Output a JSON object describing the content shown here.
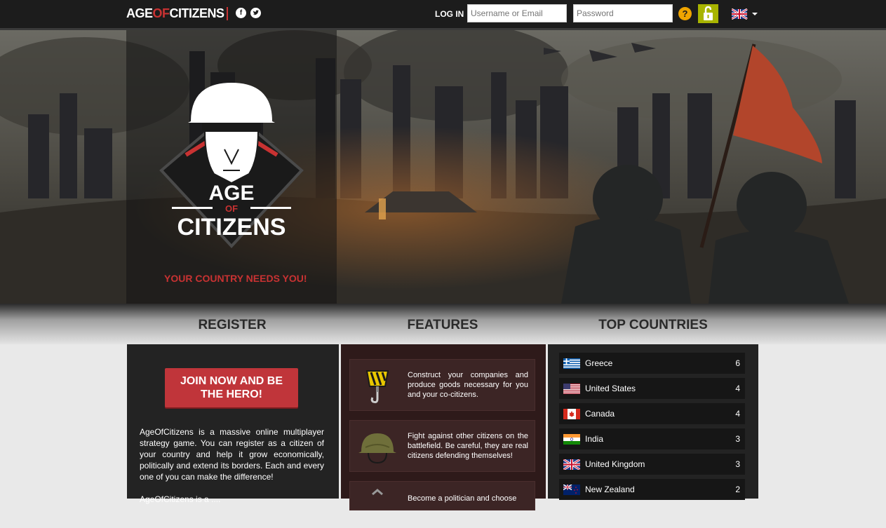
{
  "header": {
    "logo_age": "AGE",
    "logo_of": "OF",
    "logo_citizens": "CITIZENS",
    "login_label": "LOG IN",
    "username_placeholder": "Username or Email",
    "password_placeholder": "Password",
    "help_symbol": "?",
    "social": [
      "facebook-icon",
      "twitter-icon"
    ],
    "language": "uk-flag-icon"
  },
  "hero": {
    "emblem_line1": "AGE",
    "emblem_line2": "OF",
    "emblem_line3": "CITIZENS",
    "tagline": "YOUR COUNTRY NEEDS YOU!"
  },
  "sections": {
    "register": "REGISTER",
    "features": "FEATURES",
    "top_countries": "TOP COUNTRIES"
  },
  "register": {
    "join_button": "JOIN NOW AND BE THE HERO!",
    "description": "AgeOfCitizens is a massive online multiplayer strategy game. You can register as a citizen of your country and help it grow economically, politically and extend its borders. Each and every one of you can make the difference!",
    "description2": "AgeOfCitizens is a ...."
  },
  "features": [
    {
      "icon": "crane-hook-icon",
      "text": "Construct your companies and produce goods necessary for you and your co-citizens."
    },
    {
      "icon": "helmet-icon",
      "text": "Fight against other citizens on the battlefield. Be careful, they are real citizens defending themselves!"
    },
    {
      "icon": "politics-icon",
      "text": "Become a politician and choose"
    }
  ],
  "top_countries": [
    {
      "name": "Greece",
      "count": "6",
      "flag": "greece-flag-icon"
    },
    {
      "name": "United States",
      "count": "4",
      "flag": "usa-flag-icon"
    },
    {
      "name": "Canada",
      "count": "4",
      "flag": "canada-flag-icon"
    },
    {
      "name": "India",
      "count": "3",
      "flag": "india-flag-icon"
    },
    {
      "name": "United Kingdom",
      "count": "3",
      "flag": "uk-flag-icon"
    },
    {
      "name": "New Zealand",
      "count": "2",
      "flag": "nz-flag-icon"
    }
  ],
  "colors": {
    "accent_red": "#c83232",
    "button_red": "#c0353a",
    "unlock_green": "#a8b400",
    "help_orange": "#f0a500"
  }
}
